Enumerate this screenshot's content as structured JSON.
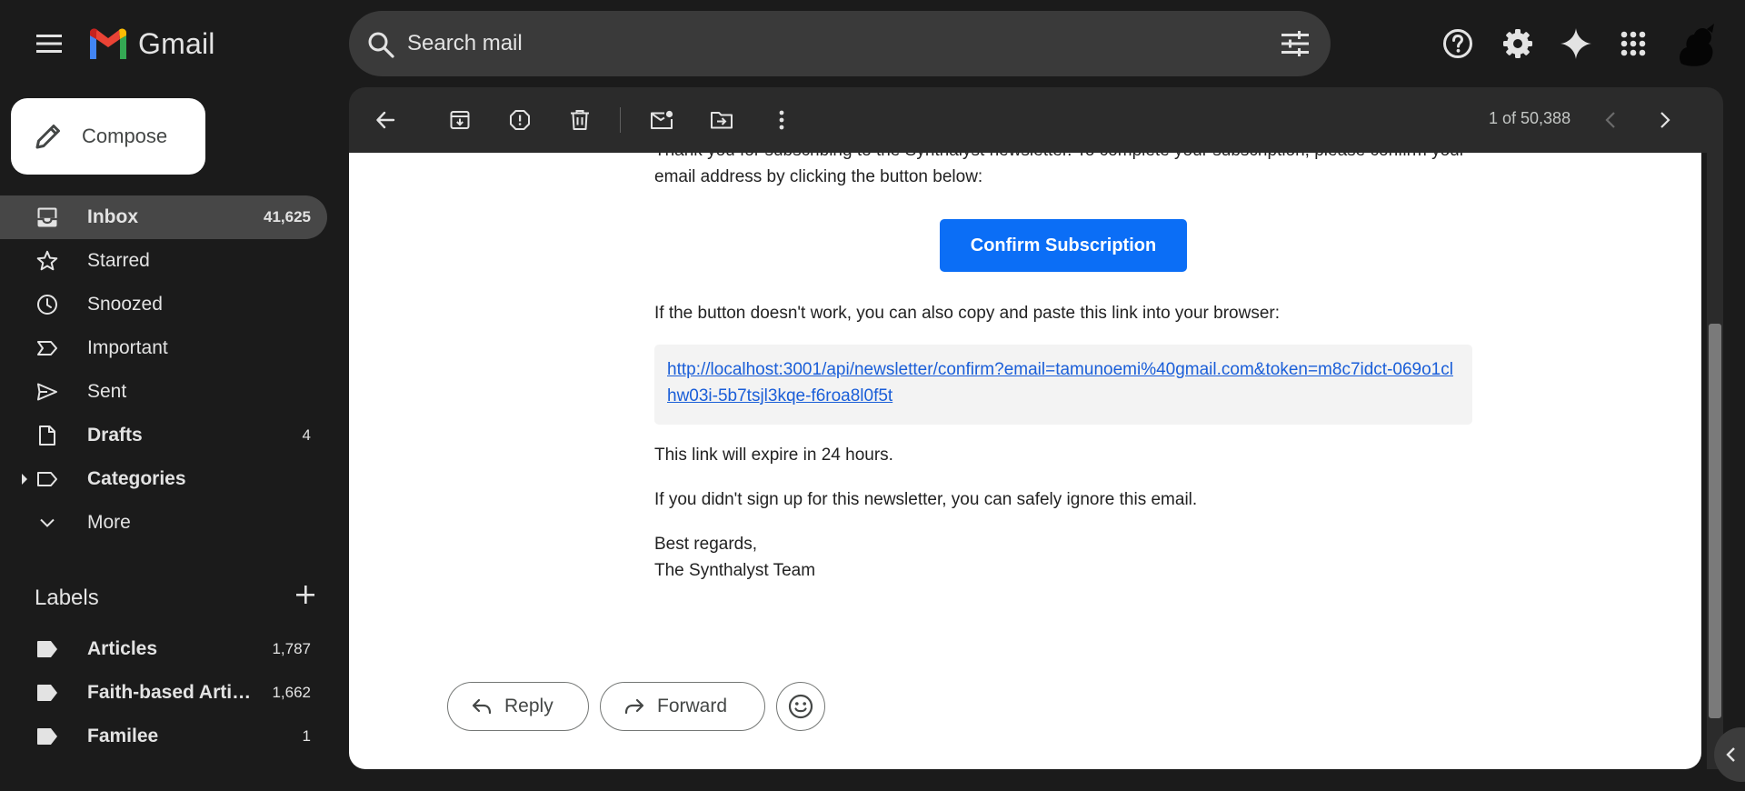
{
  "app": {
    "name": "Gmail"
  },
  "search": {
    "placeholder": "Search mail"
  },
  "compose": {
    "label": "Compose"
  },
  "nav": [
    {
      "label": "Inbox",
      "count": "41,625",
      "icon": "inbox-icon",
      "active": true,
      "bold": true
    },
    {
      "label": "Starred",
      "count": "",
      "icon": "star-icon"
    },
    {
      "label": "Snoozed",
      "count": "",
      "icon": "clock-icon"
    },
    {
      "label": "Important",
      "count": "",
      "icon": "important-icon"
    },
    {
      "label": "Sent",
      "count": "",
      "icon": "send-icon"
    },
    {
      "label": "Drafts",
      "count": "4",
      "icon": "draft-icon",
      "bold": true
    },
    {
      "label": "Categories",
      "count": "",
      "icon": "label-icon",
      "bold": true
    },
    {
      "label": "More",
      "count": "",
      "icon": "chevron-down-icon"
    }
  ],
  "labels": {
    "title": "Labels",
    "items": [
      {
        "label": "Articles",
        "count": "1,787"
      },
      {
        "label": "Faith-based Articles",
        "count": "1,662"
      },
      {
        "label": "Familee",
        "count": "1"
      }
    ]
  },
  "toolbar": {
    "pager": "1 of 50,388"
  },
  "email": {
    "intro": "Thank you for subscribing to the Synthalyst newsletter. To complete your subscription, please confirm your email address by clicking the button below:",
    "confirm_button": "Confirm Subscription",
    "fallback": "If the button doesn't work, you can also copy and paste this link into your browser:",
    "link": "http://localhost:3001/api/newsletter/confirm?email=tamunoemi%40gmail.com&token=m8c7idct-069o1clhw03i-5b7tsjl3kqe-f6roa8l0f5t",
    "expire": "This link will expire in 24 hours.",
    "ignore": "If you didn't sign up for this newsletter, you can safely ignore this email.",
    "regards": "Best regards,",
    "team": "The Synthalyst Team"
  },
  "actions": {
    "reply": "Reply",
    "forward": "Forward"
  },
  "colors": {
    "accent": "#0b6ef6",
    "link": "#1a5ed8",
    "background": "#1b1b1b"
  }
}
